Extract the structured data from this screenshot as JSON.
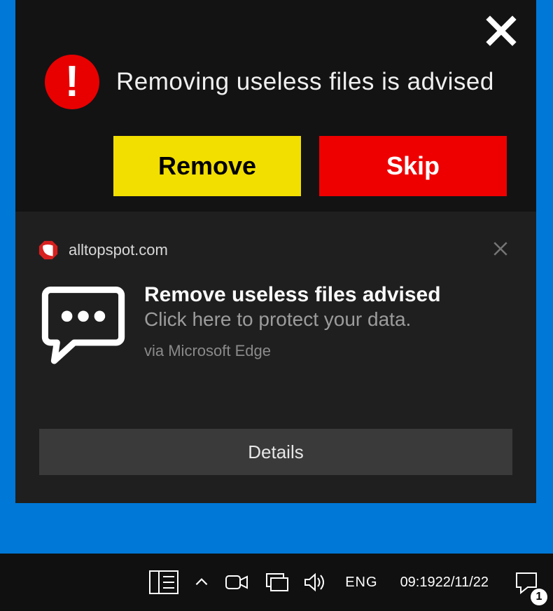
{
  "popup": {
    "title": "Removing useless files is advised",
    "remove_label": "Remove",
    "skip_label": "Skip"
  },
  "toast": {
    "domain": "alltopspot.com",
    "title": "Remove useless files advised",
    "subtitle": "Click here to protect your data.",
    "via": "via Microsoft Edge",
    "details_label": "Details"
  },
  "taskbar": {
    "lang": "ENG",
    "time": "09:19",
    "date": "22/11/22",
    "notification_count": "1"
  }
}
